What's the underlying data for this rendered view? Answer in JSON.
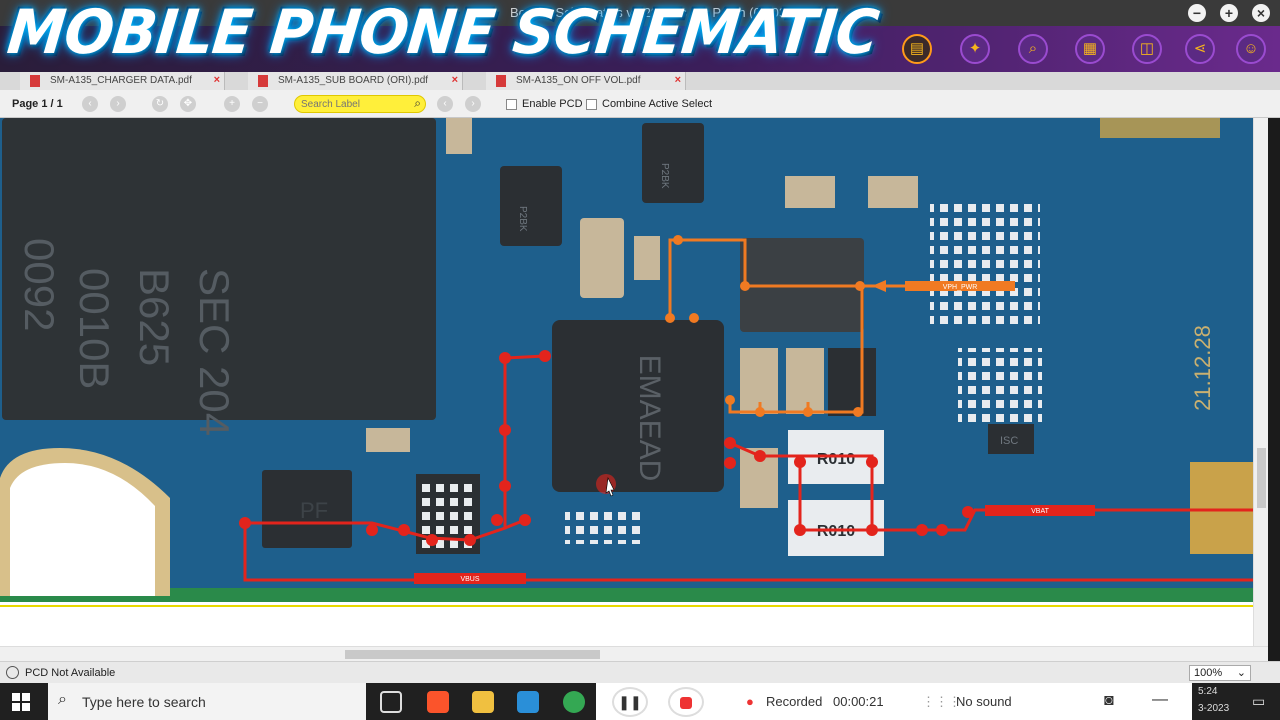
{
  "window": {
    "title": "Borneo Schematics v1.28 Map 8th Patch (08.03)",
    "controls": [
      "minimize",
      "maximize",
      "close"
    ]
  },
  "brand_overlay": "MOBILE PHONE SCHEMATIC",
  "ribbon_icons": [
    "book-icon",
    "magic-wand-icon",
    "zoom-icon",
    "calendar-icon",
    "screenshot-icon",
    "share-icon",
    "user-icon"
  ],
  "tabs": [
    {
      "label": "SM-A135_CHARGER DATA.pdf"
    },
    {
      "label": "SM-A135_SUB BOARD (ORI).pdf"
    },
    {
      "label": "SM-A135_ON OFF VOL.pdf"
    }
  ],
  "toolbar": {
    "page": "Page 1 / 1",
    "search_placeholder": "Search Label",
    "enable_pcd": "Enable PCD",
    "combine_active_select": "Combine Active Select"
  },
  "board": {
    "chip_main_text": [
      "SEC 204",
      "B625",
      "0010B",
      "0092"
    ],
    "pmic_text": "EMAEAD",
    "small_chip_text": "P2BK",
    "resistor_labels": [
      "R010",
      "R010"
    ],
    "pf_label": "PF",
    "isc_label": "ISC",
    "date_print": "21.12.28",
    "net_labels": {
      "vbus": "VBUS",
      "vbat": "VBAT",
      "vph_pwr": "VPH_PWR"
    },
    "colors": {
      "board": "#1e5f8c",
      "trace_red": "#e3241c",
      "trace_orange": "#f07a22",
      "gold": "#c9a24a"
    }
  },
  "statusbar": {
    "pcd_status": "PCD Not Available",
    "zoom": "100%"
  },
  "taskbar": {
    "search_placeholder": "Type here to search",
    "recorder": {
      "status": "Recorded",
      "time": "00:00:21",
      "audio": "No sound"
    },
    "clock_time": "5:24",
    "clock_date": "3-2023"
  }
}
